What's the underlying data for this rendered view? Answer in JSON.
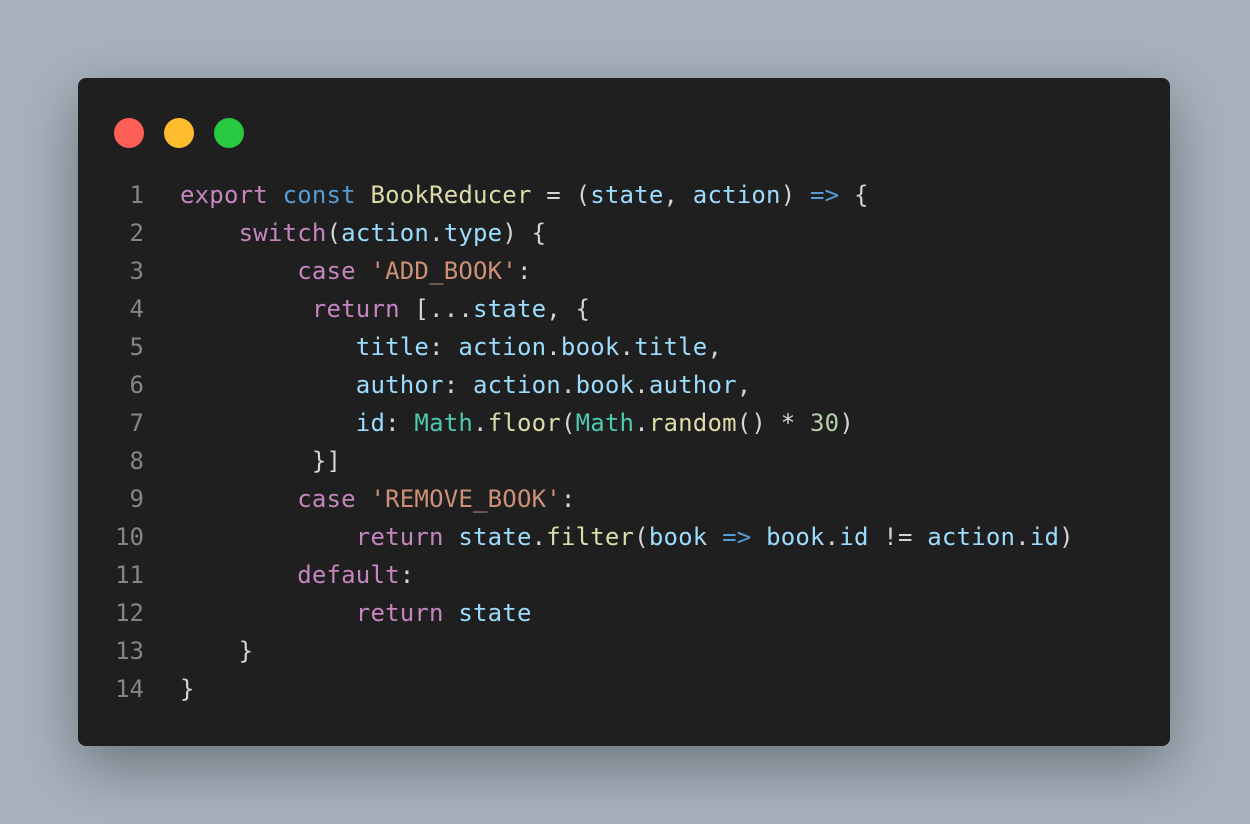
{
  "window": {
    "controls": [
      "close",
      "minimize",
      "maximize"
    ],
    "colors": {
      "close": "#ff5f57",
      "minimize": "#febc2e",
      "maximize": "#28c840"
    }
  },
  "code": {
    "language": "javascript",
    "lines": [
      {
        "num": "1",
        "tokens": [
          [
            "k",
            "export"
          ],
          [
            "p",
            " "
          ],
          [
            "kb",
            "const"
          ],
          [
            "p",
            " "
          ],
          [
            "fn",
            "BookReducer"
          ],
          [
            "p",
            " = ("
          ],
          [
            "v",
            "state"
          ],
          [
            "p",
            ", "
          ],
          [
            "v",
            "action"
          ],
          [
            "p",
            ") "
          ],
          [
            "kb",
            "=>"
          ],
          [
            "p",
            " {"
          ]
        ]
      },
      {
        "num": "2",
        "tokens": [
          [
            "p",
            "    "
          ],
          [
            "k",
            "switch"
          ],
          [
            "p",
            "("
          ],
          [
            "v",
            "action"
          ],
          [
            "p",
            "."
          ],
          [
            "v",
            "type"
          ],
          [
            "p",
            ") {"
          ]
        ]
      },
      {
        "num": "3",
        "tokens": [
          [
            "p",
            "        "
          ],
          [
            "k",
            "case"
          ],
          [
            "p",
            " "
          ],
          [
            "s",
            "'ADD_BOOK'"
          ],
          [
            "p",
            ":"
          ]
        ]
      },
      {
        "num": "4",
        "tokens": [
          [
            "p",
            "         "
          ],
          [
            "k",
            "return"
          ],
          [
            "p",
            " [..."
          ],
          [
            "v",
            "state"
          ],
          [
            "p",
            ", {"
          ]
        ]
      },
      {
        "num": "5",
        "tokens": [
          [
            "p",
            "            "
          ],
          [
            "v",
            "title"
          ],
          [
            "p",
            ": "
          ],
          [
            "v",
            "action"
          ],
          [
            "p",
            "."
          ],
          [
            "v",
            "book"
          ],
          [
            "p",
            "."
          ],
          [
            "v",
            "title"
          ],
          [
            "p",
            ","
          ]
        ]
      },
      {
        "num": "6",
        "tokens": [
          [
            "p",
            "            "
          ],
          [
            "v",
            "author"
          ],
          [
            "p",
            ": "
          ],
          [
            "v",
            "action"
          ],
          [
            "p",
            "."
          ],
          [
            "v",
            "book"
          ],
          [
            "p",
            "."
          ],
          [
            "v",
            "author"
          ],
          [
            "p",
            ","
          ]
        ]
      },
      {
        "num": "7",
        "tokens": [
          [
            "p",
            "            "
          ],
          [
            "v",
            "id"
          ],
          [
            "p",
            ": "
          ],
          [
            "t",
            "Math"
          ],
          [
            "p",
            "."
          ],
          [
            "fn",
            "floor"
          ],
          [
            "p",
            "("
          ],
          [
            "t",
            "Math"
          ],
          [
            "p",
            "."
          ],
          [
            "fn",
            "random"
          ],
          [
            "p",
            "() * "
          ],
          [
            "n",
            "30"
          ],
          [
            "p",
            ")"
          ]
        ]
      },
      {
        "num": "8",
        "tokens": [
          [
            "p",
            "         }]"
          ]
        ]
      },
      {
        "num": "9",
        "tokens": [
          [
            "p",
            "        "
          ],
          [
            "k",
            "case"
          ],
          [
            "p",
            " "
          ],
          [
            "s",
            "'REMOVE_BOOK'"
          ],
          [
            "p",
            ":"
          ]
        ]
      },
      {
        "num": "10",
        "tokens": [
          [
            "p",
            "            "
          ],
          [
            "k",
            "return"
          ],
          [
            "p",
            " "
          ],
          [
            "v",
            "state"
          ],
          [
            "p",
            "."
          ],
          [
            "fn",
            "filter"
          ],
          [
            "p",
            "("
          ],
          [
            "v",
            "book"
          ],
          [
            "p",
            " "
          ],
          [
            "kb",
            "=>"
          ],
          [
            "p",
            " "
          ],
          [
            "v",
            "book"
          ],
          [
            "p",
            "."
          ],
          [
            "v",
            "id"
          ],
          [
            "p",
            " != "
          ],
          [
            "v",
            "action"
          ],
          [
            "p",
            "."
          ],
          [
            "v",
            "id"
          ],
          [
            "p",
            ")"
          ]
        ]
      },
      {
        "num": "11",
        "tokens": [
          [
            "p",
            "        "
          ],
          [
            "k",
            "default"
          ],
          [
            "p",
            ":"
          ]
        ]
      },
      {
        "num": "12",
        "tokens": [
          [
            "p",
            "            "
          ],
          [
            "k",
            "return"
          ],
          [
            "p",
            " "
          ],
          [
            "v",
            "state"
          ]
        ]
      },
      {
        "num": "13",
        "tokens": [
          [
            "p",
            "    }"
          ]
        ]
      },
      {
        "num": "14",
        "tokens": [
          [
            "p",
            "}"
          ]
        ]
      }
    ]
  }
}
